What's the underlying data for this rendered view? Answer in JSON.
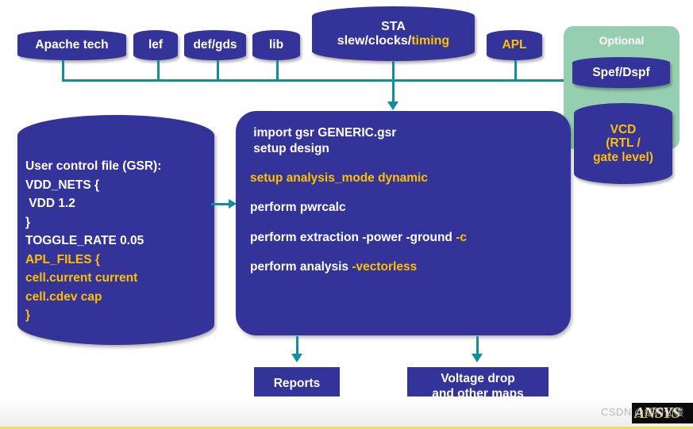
{
  "colors": {
    "box_blue": "#333399",
    "accent_orange": "#ffc000",
    "connector_teal": "#0e8f9c",
    "optional_green": "#96ceb0",
    "text_white": "#ffffff",
    "footer_rule_yellow": "#f2dd63"
  },
  "inputs": {
    "apache_tech": "Apache tech",
    "lef": "lef",
    "def_gds": "def/gds",
    "lib": "lib",
    "apl": "APL"
  },
  "sta": {
    "line1": "STA",
    "line2_white": "slew/clocks/",
    "line2_orange": "timing"
  },
  "optional": {
    "title": "Optional",
    "spef_dspf": "Spef/Dspf",
    "vcd_line1": "VCD",
    "vcd_line2": "(RTL /",
    "vcd_line3": "gate level)"
  },
  "gsr": {
    "lines": [
      {
        "text": "User control file (GSR):",
        "color": "white"
      },
      {
        "text": "VDD_NETS {",
        "color": "white"
      },
      {
        "text": " VDD 1.2",
        "color": "white"
      },
      {
        "text": "}",
        "color": "white"
      },
      {
        "text": "TOGGLE_RATE 0.05",
        "color": "white"
      },
      {
        "text": "APL_FILES {",
        "color": "orange"
      },
      {
        "text": "cell.current current",
        "color": "orange"
      },
      {
        "text": "cell.cdev cap",
        "color": "orange"
      },
      {
        "text": "}",
        "color": "orange"
      }
    ]
  },
  "commands": {
    "groups": [
      {
        "lines": [
          {
            "segments": [
              {
                "text": " import gsr GENERIC.gsr",
                "color": "white"
              }
            ]
          },
          {
            "segments": [
              {
                "text": " setup design",
                "color": "white"
              }
            ]
          }
        ]
      },
      {
        "lines": [
          {
            "segments": [
              {
                "text": "setup analysis_mode dynamic",
                "color": "orange"
              }
            ]
          }
        ]
      },
      {
        "lines": [
          {
            "segments": [
              {
                "text": "perform pwrcalc",
                "color": "white"
              }
            ]
          }
        ]
      },
      {
        "lines": [
          {
            "segments": [
              {
                "text": "perform extraction -power -ground ",
                "color": "white"
              },
              {
                "text": "-c",
                "color": "orange"
              }
            ]
          }
        ]
      },
      {
        "lines": [
          {
            "segments": [
              {
                "text": "perform analysis ",
                "color": "white"
              },
              {
                "text": "-vectorless",
                "color": "orange"
              }
            ]
          }
        ]
      }
    ]
  },
  "outputs": {
    "reports": "Reports",
    "voltage_line1": "Voltage drop",
    "voltage_line2": "and other maps"
  },
  "watermark": {
    "csdn": "CSDN",
    "handle": "@结构仙楼",
    "brand": "ANSYS"
  }
}
